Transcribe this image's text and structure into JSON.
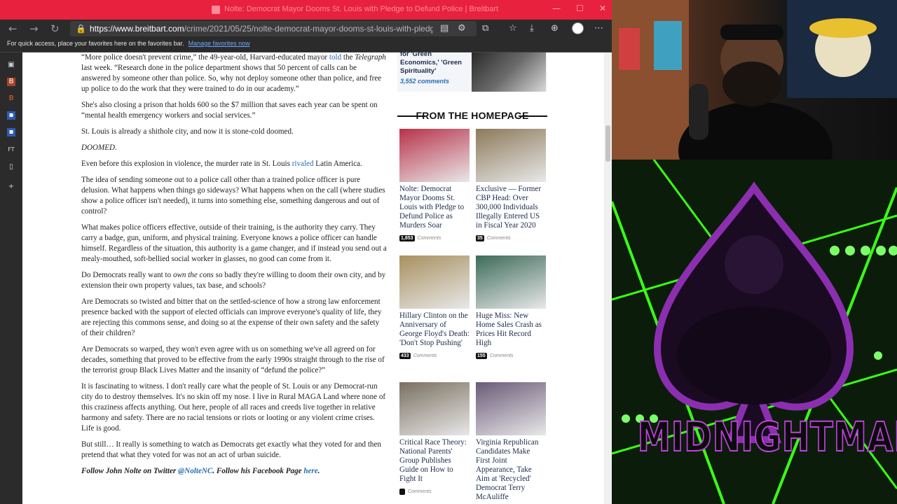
{
  "browser": {
    "window_title": "Nolte: Democrat Mayor Dooms St. Louis with Pledge to Defund Police | Breitbart",
    "url_domain": "https://www.breitbart.com",
    "url_path": "/crime/2021/05/25/nolte-democrat-mayor-dooms-st-louis-with-pledge-...",
    "favorites_bar_text": "For quick access, place your favorites here on the favorites bar.",
    "favorites_link": "Manage favorites now",
    "icons": [
      "back-arrow-icon",
      "forward-arrow-icon",
      "refresh-icon",
      "lock-icon",
      "reader-mode-icon",
      "tracking-icon",
      "extension-icon",
      "favorites-star-icon",
      "collections-icon",
      "downloads-icon",
      "profile-icon",
      "more-icon"
    ]
  },
  "article": {
    "p1_a": "“More police doesn't prevent crime,” the 49-year-old, Harvard-educated mayor ",
    "p1_link": "told",
    "p1_b": " the ",
    "p1_pub": "Telegraph",
    "p1_c": " last week. “Research done in the police department shows that 50 percent of calls can be answered by someone other than police. So, why not deploy someone other than police, and free up police to do the work that they were trained to do in our academy.”",
    "p2": "She's also closing a prison that holds 600 so the $7 million that saves each year can be spent on “mental health emergency workers and social services.”",
    "p3": "St. Louis is already a shithole city, and now it is stone-cold doomed.",
    "p4": "DOOMED.",
    "p5_a": "Even before this explosion in violence, the murder rate in St. Louis ",
    "p5_link": "rivaled",
    "p5_b": " Latin America.",
    "p6": "The idea of sending someone out to a police call other than a trained police officer is pure delusion. What happens when things go sideways? What happens when on the call (where studies show a police officer isn't needed), it turns into something else, something dangerous and out of control?",
    "p7": "What makes police officers effective, outside of their training, is the authority they carry. They carry a badge, gun, uniform, and physical training. Everyone knows a police officer can handle himself. Regardless of the situation, this authority is a game changer, and if instead you send out a mealy-mouthed, soft-bellied social worker in glasses, no good can come from it.",
    "p8_a": "Do Democrats really want to ",
    "p8_i": "own the cons",
    "p8_b": " so badly they're willing to doom their own city, and by extension their own property values, tax base, and schools?",
    "p9": "Are Democrats so twisted and bitter that on the settled-science of how a strong law enforcement presence backed with the support of elected officials can improve everyone's quality of life, they are rejecting this commons sense, and doing so at the expense of their own safety and the safety of their children?",
    "p10": "Are Democrats so warped, they won't even agree with us on something we've all agreed on for decades, something that proved to be effective from the early 1990s straight through to the rise of the terrorist group Black Lives Matter and the insanity of “defund the police?”",
    "p11": "It is fascinating to witness. I don't really care what the people of St. Louis or any Democrat-run city do to destroy themselves. It's no skin off my nose. I live in Rural MAGA Land where none of this craziness affects anything. Out here, people of all races and creeds live together in relative harmony and safety. There are no racial tensions or riots or looting or any violent crime crises. Life is good.",
    "p12": "But still… It really is something to watch as Democrats get exactly what they voted for and then pretend that what they voted for was not an act of urban suicide.",
    "follow_a": "Follow John Nolte on Twitter ",
    "follow_handle": "@NolteNC",
    "follow_b": ". Follow his Facebook Page ",
    "follow_link": "here",
    "follow_c": "."
  },
  "sidebar": {
    "top_story_text": "for 'Green Economics,' 'Green Spirituality'",
    "top_story_comments": "3,552 comments",
    "section_title": "FROM THE HOMEPAGE",
    "comments_word": "Comments",
    "cards": [
      {
        "headline": "Nolte: Democrat Mayor Dooms St. Louis with Pledge to Defund Police as Murders Soar",
        "count": "1,853",
        "color": "#b8324a"
      },
      {
        "headline": "Exclusive — Former CBP Head: Over 300,000 Individuals Illegally Entered US in Fiscal Year 2020",
        "count": "35",
        "color": "#8c7a5a"
      },
      {
        "headline": "Hillary Clinton on the Anniversary of George Floyd's Death: 'Don't Stop Pushing'",
        "count": "433",
        "color": "#a89060"
      },
      {
        "headline": "Huge Miss: New Home Sales Crash as Prices Hit Record High",
        "count": "155",
        "color": "#3d6b5a"
      },
      {
        "headline": "Critical Race Theory: National Parents' Group Publishes Guide on How to Fight It",
        "count": "",
        "color": "#7a7060"
      },
      {
        "headline": "Virginia Republican Candidates Make First Joint Appearance, Take Aim at 'Recycled' Democrat Terry McAuliffe",
        "count": "",
        "color": "#6a5a78"
      }
    ]
  },
  "overlay": {
    "brand": "MIDNIGHTMAN",
    "accent_green": "#39ff14",
    "accent_purple": "#b040e0"
  }
}
